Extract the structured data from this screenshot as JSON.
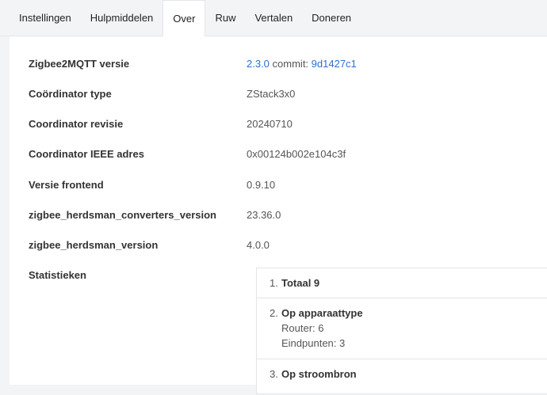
{
  "tabs": [
    {
      "label": "Instellingen"
    },
    {
      "label": "Hulpmiddelen"
    },
    {
      "label": "Over"
    },
    {
      "label": "Ruw"
    },
    {
      "label": "Vertalen"
    },
    {
      "label": "Doneren"
    }
  ],
  "active_tab": "Over",
  "info": {
    "z2m": {
      "label": "Zigbee2MQTT versie",
      "version": "2.3.0",
      "commit_label": "commit:",
      "commit": "9d1427c1"
    },
    "coordinator_type": {
      "label": "Coördinator type",
      "value": "ZStack3x0"
    },
    "coordinator_revision": {
      "label": "Coordinator revisie",
      "value": "20240710"
    },
    "coordinator_ieee": {
      "label": "Coordinator IEEE adres",
      "value": "0x00124b002e104c3f"
    },
    "frontend": {
      "label": "Versie frontend",
      "value": "0.9.10"
    },
    "converters": {
      "label": "zigbee_herdsman_converters_version",
      "value": "23.36.0"
    },
    "herdsman": {
      "label": "zigbee_herdsman_version",
      "value": "4.0.0"
    },
    "stats_label": "Statistieken"
  },
  "stats": {
    "items": [
      {
        "num": "1.",
        "title": "Totaal 9"
      },
      {
        "num": "2.",
        "title": "Op apparaattype",
        "lines": [
          "Router: 6",
          "Eindpunten: 3"
        ]
      },
      {
        "num": "3.",
        "title": "Op stroombron"
      }
    ]
  }
}
